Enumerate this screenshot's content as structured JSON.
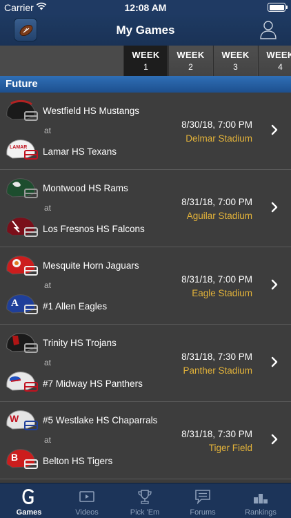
{
  "status": {
    "carrier": "Carrier",
    "time": "12:08 AM"
  },
  "nav": {
    "title": "My Games"
  },
  "weeks": [
    {
      "label": "WEEK",
      "num": "1"
    },
    {
      "label": "WEEK",
      "num": "2"
    },
    {
      "label": "WEEK",
      "num": "3"
    },
    {
      "label": "WEEK",
      "num": "4"
    }
  ],
  "section": {
    "title": "Future"
  },
  "games": [
    {
      "home": "Westfield HS Mustangs",
      "at": "at",
      "away": "Lamar HS Texans",
      "date": "8/30/18, 7:00 PM",
      "venue": "Delmar Stadium"
    },
    {
      "home": "Montwood HS Rams",
      "at": "at",
      "away": "Los Fresnos HS Falcons",
      "date": "8/31/18, 7:00 PM",
      "venue": "Aguilar Stadium"
    },
    {
      "home": "Mesquite Horn Jaguars",
      "at": "at",
      "away": "#1 Allen Eagles",
      "date": "8/31/18, 7:00 PM",
      "venue": "Eagle Stadium"
    },
    {
      "home": "Trinity HS Trojans",
      "at": "at",
      "away": "#7 Midway HS Panthers",
      "date": "8/31/18, 7:30 PM",
      "venue": "Panther Stadium"
    },
    {
      "home": "#5 Westlake HS Chaparrals",
      "at": "at",
      "away": "Belton HS Tigers",
      "date": "8/31/18, 7:30 PM",
      "venue": "Tiger Field"
    }
  ],
  "tabs": [
    {
      "label": "Games",
      "icon": "games-g-icon"
    },
    {
      "label": "Videos",
      "icon": "video-icon"
    },
    {
      "label": "Pick 'Em",
      "icon": "trophy-icon"
    },
    {
      "label": "Forums",
      "icon": "forums-icon"
    },
    {
      "label": "Rankings",
      "icon": "rankings-icon"
    }
  ],
  "colors": {
    "nav": "#1e3a62",
    "section": "#2f6fb6",
    "venue": "#e2b23a",
    "row": "#3d3d3d"
  }
}
